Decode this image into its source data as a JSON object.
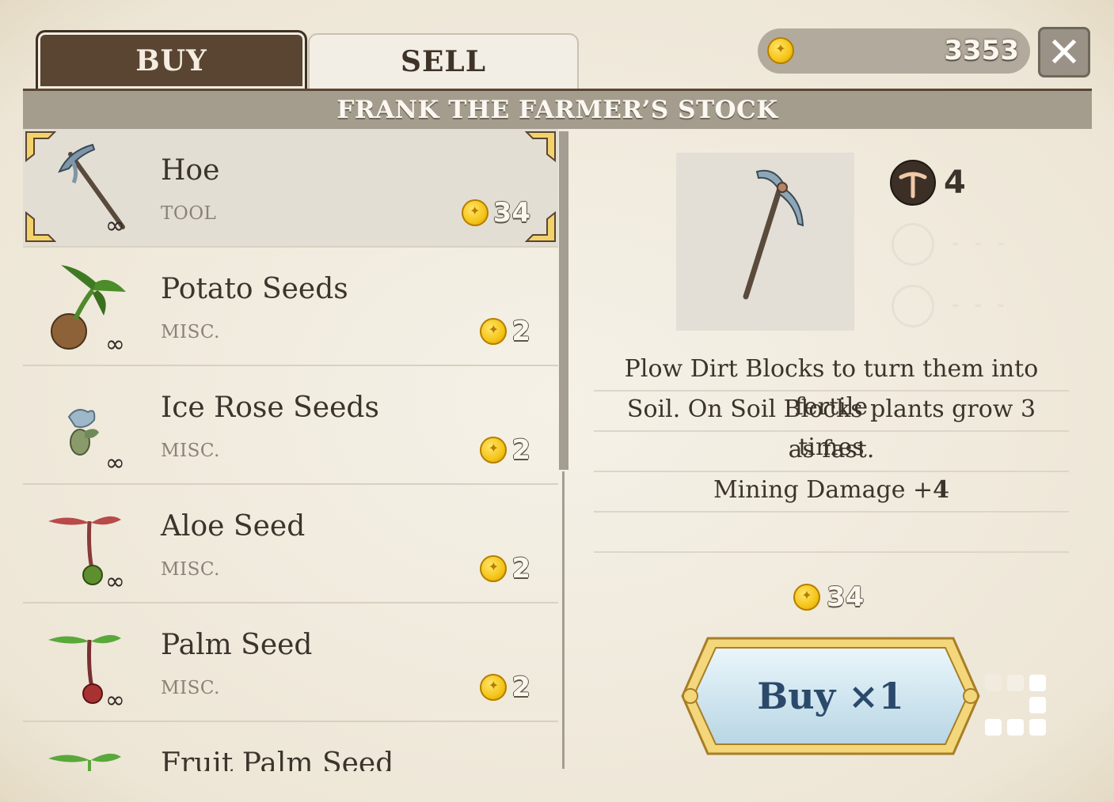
{
  "tabs": {
    "buy": "BUY",
    "sell": "SELL"
  },
  "currency": {
    "balance": "3353",
    "icon": "gold-coin-icon"
  },
  "close_icon": "close-icon",
  "shop_title": "FRANK THE FARMER’S STOCK",
  "items": [
    {
      "name": "Hoe",
      "category": "TOOL",
      "price": "34",
      "stock": "∞",
      "icon": "hoe-icon",
      "selected": true
    },
    {
      "name": "Potato Seeds",
      "category": "MISC.",
      "price": "2",
      "stock": "∞",
      "icon": "potato-seed-icon"
    },
    {
      "name": "Ice Rose Seeds",
      "category": "MISC.",
      "price": "2",
      "stock": "∞",
      "icon": "ice-rose-seed-icon"
    },
    {
      "name": "Aloe Seed",
      "category": "MISC.",
      "price": "2",
      "stock": "∞",
      "icon": "aloe-seed-icon"
    },
    {
      "name": "Palm Seed",
      "category": "MISC.",
      "price": "2",
      "stock": "∞",
      "icon": "palm-seed-icon"
    },
    {
      "name": "Fruit Palm Seed",
      "category": "",
      "price": "",
      "stock": "",
      "icon": "fruit-palm-seed-icon"
    }
  ],
  "detail": {
    "stat_value": "4",
    "stat_icon": "pickaxe-stat-icon",
    "empty_slot": "- - -",
    "description_lines": [
      "Plow Dirt Blocks to turn them into fertile",
      "Soil. On Soil Blocks plants grow 3 times",
      "as fast."
    ],
    "bonus_label": "Mining Damage +",
    "bonus_value": "4",
    "cost": "34",
    "buy_label": "Buy ×1"
  }
}
